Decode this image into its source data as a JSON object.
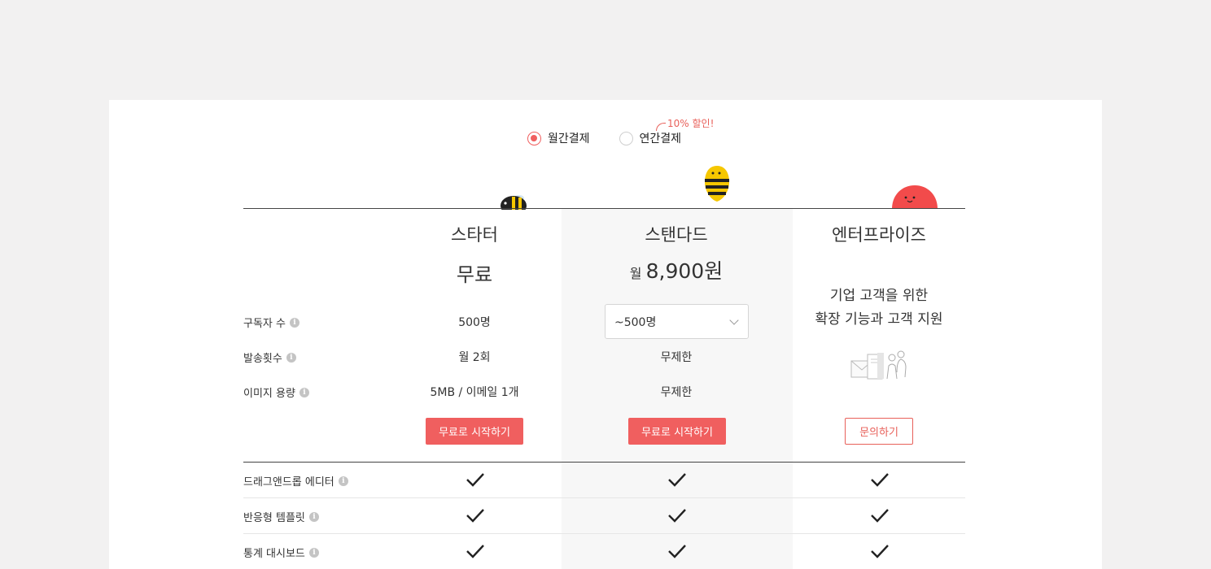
{
  "billing": {
    "monthly_label": "월간결제",
    "yearly_label": "연간결제",
    "selected": "monthly",
    "discount_note": "10% 할인!"
  },
  "plans": [
    {
      "name": "스타터",
      "price": "무료",
      "subscribers": "500명",
      "sends": "월 2회",
      "image": "5MB / 이메일 1개",
      "cta": "무료로 시작하기"
    },
    {
      "name": "스탠다드",
      "price_prefix": "월",
      "price": "8,900원",
      "subscribers_select": "~500명",
      "sends": "무제한",
      "image": "무제한",
      "cta": "무료로 시작하기"
    },
    {
      "name": "엔터프라이즈",
      "desc_line1": "기업 고객을 위한",
      "desc_line2": "확장 기능과 고객 지원",
      "cta": "문의하기"
    }
  ],
  "rows": {
    "subscribers": "구독자 수",
    "sends": "발송횟수",
    "image": "이미지 용량"
  },
  "features": [
    {
      "label": "드래그앤드롭 에디터",
      "starter": true,
      "standard": true,
      "enterprise": true
    },
    {
      "label": "반응형 템플릿",
      "starter": true,
      "standard": true,
      "enterprise": true
    },
    {
      "label": "통계 대시보드",
      "starter": true,
      "standard": true,
      "enterprise": true
    }
  ],
  "colors": {
    "accent": "#f05f5f",
    "bee": "#f6c700",
    "enterprise_mascot": "#f24b4b"
  },
  "info_icon_glyph": "i"
}
